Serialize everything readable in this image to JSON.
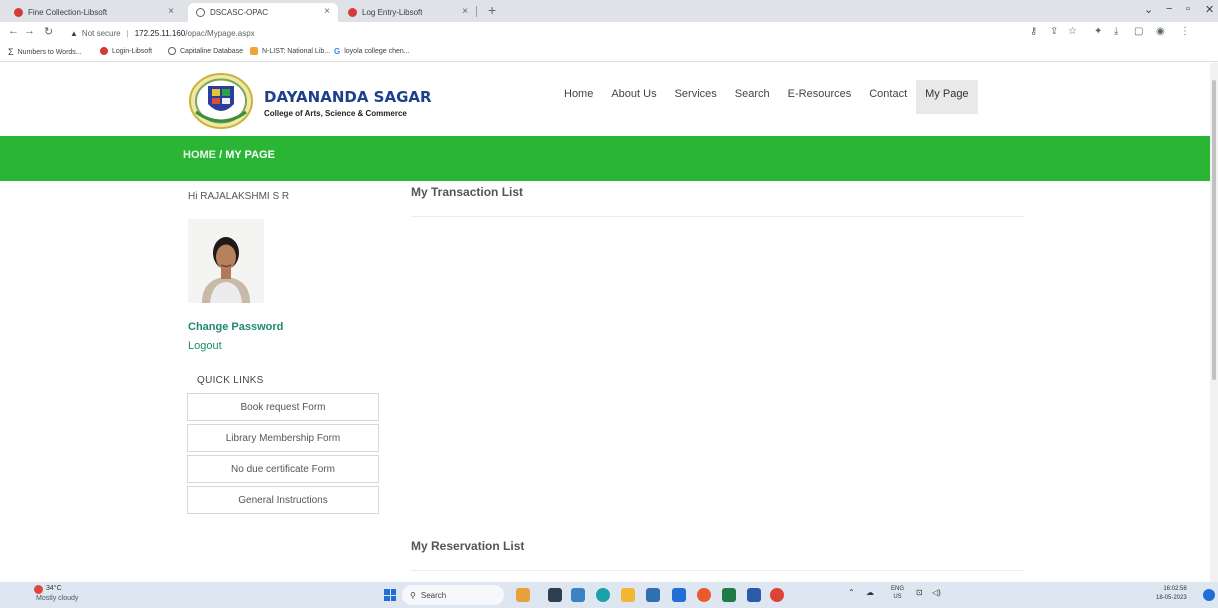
{
  "browser": {
    "tabs": [
      {
        "title": "Fine Collection-Libsoft",
        "icon": "libsoft-favicon"
      },
      {
        "title": "DSCASC-OPAC",
        "icon": "globe-favicon",
        "active": true
      },
      {
        "title": "Log Entry-Libsoft",
        "icon": "libsoft-favicon"
      }
    ],
    "tab_close_glyph": "×",
    "new_tab_glyph": "+",
    "url": {
      "security_label": "Not secure",
      "host": "172.25.11.160",
      "path": "/opac/Mypage.aspx"
    },
    "bookmarks": [
      "Numbers to Words...",
      "Login-Libsoft",
      "Capitaline Database",
      "N-LIST: National Lib...",
      "loyola college chen..."
    ]
  },
  "site": {
    "brand_name": "DAYANANDA SAGAR",
    "brand_sub": "College of Arts, Science & Commerce",
    "nav": [
      "Home",
      "About Us",
      "Services",
      "Search",
      "E-Resources",
      "Contact",
      "My Page"
    ],
    "active_nav": "My Page",
    "breadcrumb": {
      "home": "HOME",
      "separator": "/",
      "current": "MY PAGE"
    },
    "accent_green": "#2ab534",
    "brand_blue": "#1e3f8a"
  },
  "sidebar": {
    "greeting": "Hi RAJALAKSHMI S R",
    "change_password": "Change Password",
    "logout": "Logout",
    "quick_links_title": "QUICK LINKS",
    "quick_links": [
      "Book request Form",
      "Library Membership Form",
      "No due certificate Form",
      "General Instructions"
    ]
  },
  "main": {
    "transaction_title": "My Transaction List",
    "reservation_title": "My Reservation List"
  },
  "taskbar": {
    "weather_temp": "34°C",
    "weather_desc": "Mostly cloudy",
    "search_label": "Search",
    "lang_top": "ENG",
    "lang_bottom": "US",
    "time": "16:02:58",
    "date": "18-05-2023"
  }
}
